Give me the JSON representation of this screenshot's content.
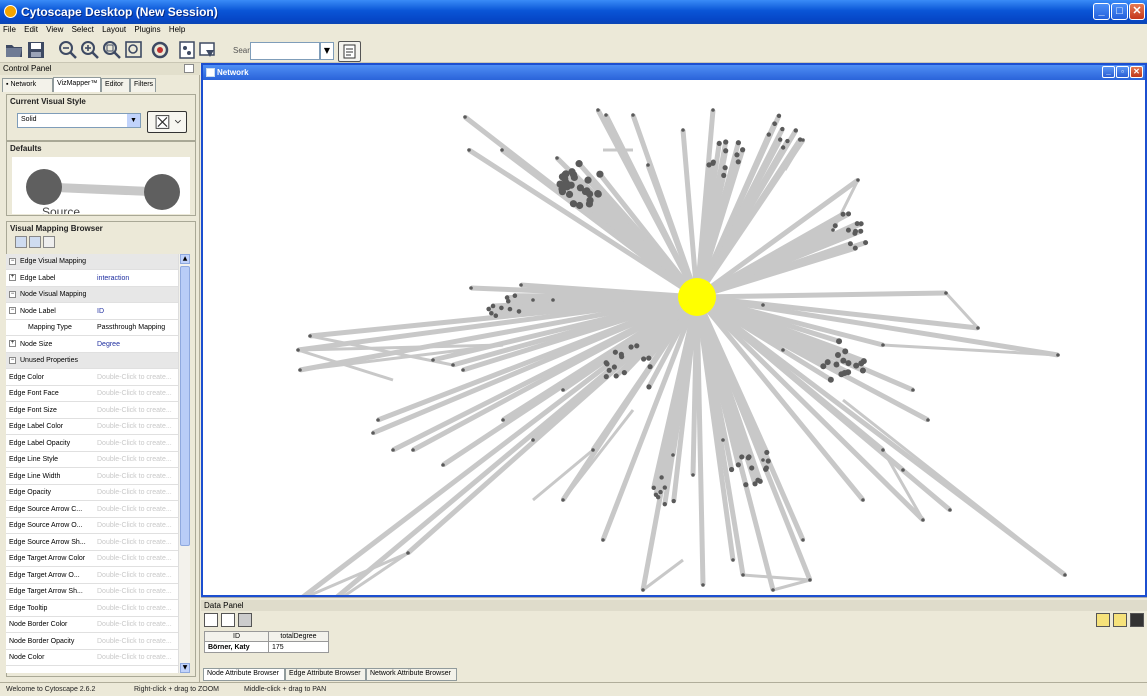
{
  "window": {
    "title": "Cytoscape Desktop (New Session)"
  },
  "menu": [
    "File",
    "Edit",
    "View",
    "Select",
    "Layout",
    "Plugins",
    "Help"
  ],
  "toolbar": {
    "icons": [
      "open-folder-icon",
      "save-icon",
      "zoom-out-icon",
      "zoom-in-icon",
      "zoom-selected-icon",
      "zoom-fit-icon",
      "refresh-icon",
      "new-network-icon",
      "filter-icon"
    ],
    "search_label": "Search:",
    "search_value": ""
  },
  "control_panel": {
    "title": "Control Panel",
    "tabs": [
      "Network",
      "VizMapper™",
      "Editor",
      "Filters"
    ],
    "active_tab": "VizMapper™",
    "current_visual_style": {
      "title": "Current Visual Style",
      "selected": "Solid"
    },
    "defaults": {
      "title": "Defaults",
      "preview_label": "Source"
    },
    "mapping_browser": {
      "title": "Visual Mapping Browser",
      "rows": [
        {
          "type": "cat",
          "key": "Edge Visual Mapping",
          "value": "",
          "sign": "-"
        },
        {
          "type": "prop",
          "key": "Edge Label",
          "value": "interaction",
          "sign": "+",
          "style": "blue"
        },
        {
          "type": "cat",
          "key": "Node Visual Mapping",
          "value": "",
          "sign": "-"
        },
        {
          "type": "prop",
          "key": "Node Label",
          "value": "ID",
          "sign": "-",
          "style": "blue"
        },
        {
          "type": "sub",
          "key": "Mapping Type",
          "value": "Passthrough Mapping",
          "sign": "",
          "style": ""
        },
        {
          "type": "prop",
          "key": "Node Size",
          "value": "Degree",
          "sign": "+",
          "style": "blue"
        },
        {
          "type": "cat",
          "key": "Unused Properties",
          "value": "",
          "sign": "-"
        },
        {
          "type": "plain",
          "key": "Edge Color",
          "value": "Double-Click to create...",
          "style": "ghost"
        },
        {
          "type": "plain",
          "key": "Edge Font Face",
          "value": "Double-Click to create...",
          "style": "ghost"
        },
        {
          "type": "plain",
          "key": "Edge Font Size",
          "value": "Double-Click to create...",
          "style": "ghost"
        },
        {
          "type": "plain",
          "key": "Edge Label Color",
          "value": "Double-Click to create...",
          "style": "ghost"
        },
        {
          "type": "plain",
          "key": "Edge Label Opacity",
          "value": "Double-Click to create...",
          "style": "ghost"
        },
        {
          "type": "plain",
          "key": "Edge Line Style",
          "value": "Double-Click to create...",
          "style": "ghost"
        },
        {
          "type": "plain",
          "key": "Edge Line Width",
          "value": "Double-Click to create...",
          "style": "ghost"
        },
        {
          "type": "plain",
          "key": "Edge Opacity",
          "value": "Double-Click to create...",
          "style": "ghost"
        },
        {
          "type": "plain",
          "key": "Edge Source Arrow C...",
          "value": "Double-Click to create...",
          "style": "ghost"
        },
        {
          "type": "plain",
          "key": "Edge Source Arrow O...",
          "value": "Double-Click to create...",
          "style": "ghost"
        },
        {
          "type": "plain",
          "key": "Edge Source Arrow Sh...",
          "value": "Double-Click to create...",
          "style": "ghost"
        },
        {
          "type": "plain",
          "key": "Edge Target Arrow Color",
          "value": "Double-Click to create...",
          "style": "ghost"
        },
        {
          "type": "plain",
          "key": "Edge Target Arrow O...",
          "value": "Double-Click to create...",
          "style": "ghost"
        },
        {
          "type": "plain",
          "key": "Edge Target Arrow Sh...",
          "value": "Double-Click to create...",
          "style": "ghost"
        },
        {
          "type": "plain",
          "key": "Edge Tooltip",
          "value": "Double-Click to create...",
          "style": "ghost"
        },
        {
          "type": "plain",
          "key": "Node Border Color",
          "value": "Double-Click to create...",
          "style": "ghost"
        },
        {
          "type": "plain",
          "key": "Node Border Opacity",
          "value": "Double-Click to create...",
          "style": "ghost"
        },
        {
          "type": "plain",
          "key": "Node Color",
          "value": "Double-Click to create...",
          "style": "ghost"
        }
      ]
    }
  },
  "network_window": {
    "title": "Network",
    "center_node_color": "#ffff00",
    "edge_color": "#c8c8c8",
    "node_color": "#5a5a5a"
  },
  "data_panel": {
    "title": "Data Panel",
    "columns": [
      "ID",
      "totalDegree"
    ],
    "rows": [
      {
        "id": "Börner, Katy",
        "totalDegree": "175"
      }
    ],
    "tabs": [
      "Node Attribute Browser",
      "Edge Attribute Browser",
      "Network Attribute Browser"
    ]
  },
  "status": {
    "welcome": "Welcome to Cytoscape 2.6.2",
    "hint_zoom": "Right-click + drag to ZOOM",
    "hint_pan": "Middle-click + drag to PAN"
  }
}
